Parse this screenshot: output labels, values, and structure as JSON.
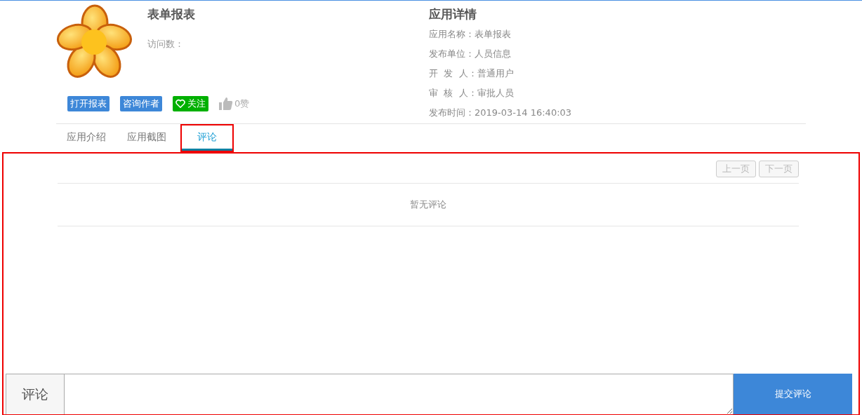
{
  "app": {
    "title": "表单报表",
    "visits_label": "访问数：",
    "actions": [
      {
        "kind": "button",
        "label": "打开报表"
      },
      {
        "kind": "button",
        "label": "咨询作者"
      },
      {
        "kind": "follow",
        "label": "关注"
      },
      {
        "kind": "like",
        "label": "0赞"
      }
    ]
  },
  "details": {
    "title": "应用详情",
    "rows": [
      "应用名称：表单报表",
      "发布单位：人员信息",
      "开  发  人：普通用户",
      "审  核  人：审批人员",
      "发布时间：2019-03-14 16:40:03"
    ]
  },
  "tabs": [
    {
      "label": "应用介绍",
      "selected": false
    },
    {
      "label": "应用截图",
      "selected": false
    },
    {
      "label": "评论",
      "selected": true
    }
  ],
  "pager": [
    {
      "label": "上一页",
      "disabled": true
    },
    {
      "label": "下一页",
      "disabled": true
    }
  ],
  "empty_message": "暂无评论",
  "comment_form": {
    "label": "评论",
    "submit": "提交评论"
  }
}
